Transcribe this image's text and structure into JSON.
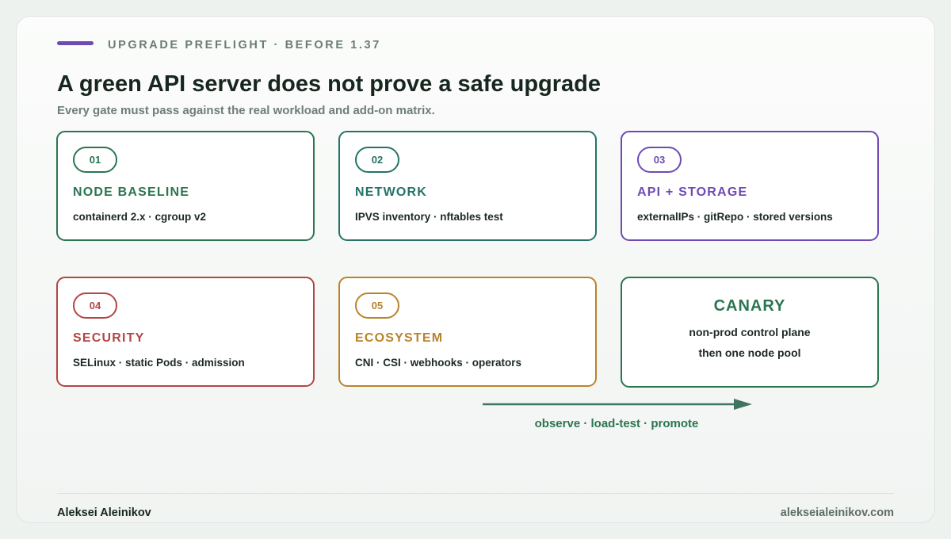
{
  "header": {
    "eyebrow": "UPGRADE PREFLIGHT · BEFORE 1.37",
    "title": "A green API server does not prove a safe upgrade",
    "subtitle": "Every gate must pass against the real workload and add-on matrix."
  },
  "gates": [
    {
      "number": "01",
      "title": "NODE BASELINE",
      "detail": "containerd 2.x · cgroup v2",
      "color": "#2b7550"
    },
    {
      "number": "02",
      "title": "NETWORK",
      "detail": "IPVS inventory · nftables test",
      "color": "#247366"
    },
    {
      "number": "03",
      "title": "API + STORAGE",
      "detail": "externalIPs · gitRepo · stored versions",
      "color": "#6f4ab5"
    },
    {
      "number": "04",
      "title": "SECURITY",
      "detail": "SELinux · static Pods · admission",
      "color": "#b24545"
    },
    {
      "number": "05",
      "title": "ECOSYSTEM",
      "detail": "CNI · CSI · webhooks · operators",
      "color": "#b8842a"
    }
  ],
  "canary": {
    "title": "CANARY",
    "line1": "non-prod control plane",
    "line2": "then one node pool",
    "color": "#2b7550"
  },
  "flow": {
    "label": "observe · load-test · promote",
    "arrow_color": "#3f7560"
  },
  "footer": {
    "author": "Aleksei Aleinikov",
    "site": "alekseialeinikov.com"
  },
  "colors": {
    "accent": "#6f4ab5",
    "background": "#eef2ef"
  }
}
